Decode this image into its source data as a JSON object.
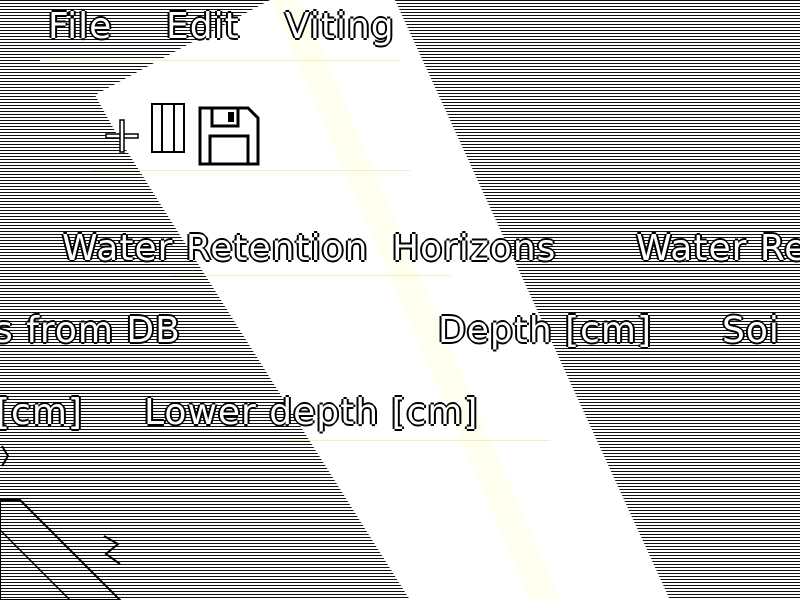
{
  "menubar": {
    "file": "File",
    "edit": "Edit",
    "view": "Viting"
  },
  "toolbar": {
    "add_icon": "plus-icon",
    "grid_icon": "grid-icon",
    "save_icon": "save-icon"
  },
  "table": {
    "title": "Water Retention",
    "horizons": "Horizons",
    "title_right": "Water Re",
    "col_from_db": "s from DB",
    "col_depth": "Depth [cm]",
    "col_soil": "Soi",
    "col_upper": "[cm]",
    "col_lower": "Lower depth [cm]"
  },
  "colors": {
    "stripe": "#111111",
    "band": "#ffffe6",
    "separator": "#f0f0c0"
  }
}
